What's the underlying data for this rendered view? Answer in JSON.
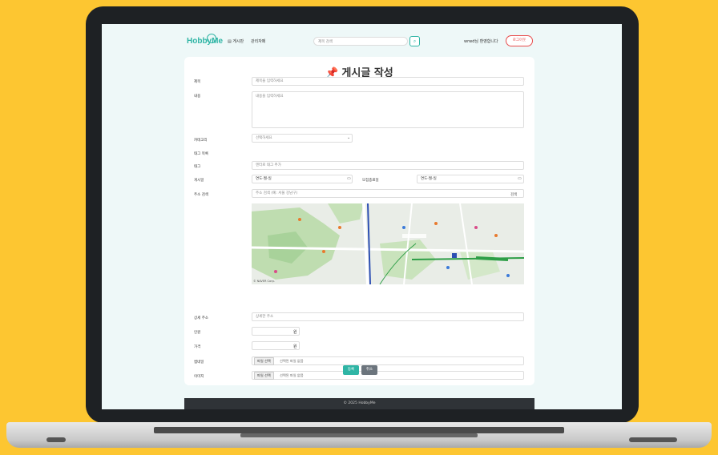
{
  "nav": {
    "logo": "HobbyMe",
    "board_label": "게시판",
    "board_icon": "board-icon",
    "admin_label": "관리자페",
    "search_placeholder": "제목 검색",
    "welcome": "wrwd님 환영합니다",
    "logout": "로그아웃"
  },
  "form": {
    "title": "게시글 작성",
    "title_label": "제목",
    "title_placeholder": "제목을 입력하세요",
    "content_label": "내용",
    "content_placeholder": "내용을 입력하세요",
    "category_label": "카테고리",
    "category_selected": "선택하세요",
    "tags_label": "태그 목록",
    "tag_label": "태그",
    "tag_placeholder": "엔터로 태그 추가",
    "start_date_label": "게시일",
    "start_date_value": "연도-월-일",
    "end_date_label": "모집종료일",
    "end_date_value": "연도-월-일",
    "address_label": "주소 검색",
    "address_placeholder": "주소 검색 (예: 서울 강남구)",
    "address_search_btn": "검색",
    "map_attribution": "© NAVER Corp.",
    "detail_address_label": "상세 주소",
    "detail_address_placeholder": "상세한 주소",
    "capacity_label": "인원",
    "price_label": "가격",
    "won_unit": "원",
    "thumbnail_label": "썸네일",
    "image_label": "이미지",
    "file_btn": "파일 선택",
    "no_file": "선택된 파일 없음",
    "submit": "등록",
    "cancel": "취소"
  },
  "footer": "© 2025 HobbyMe"
}
